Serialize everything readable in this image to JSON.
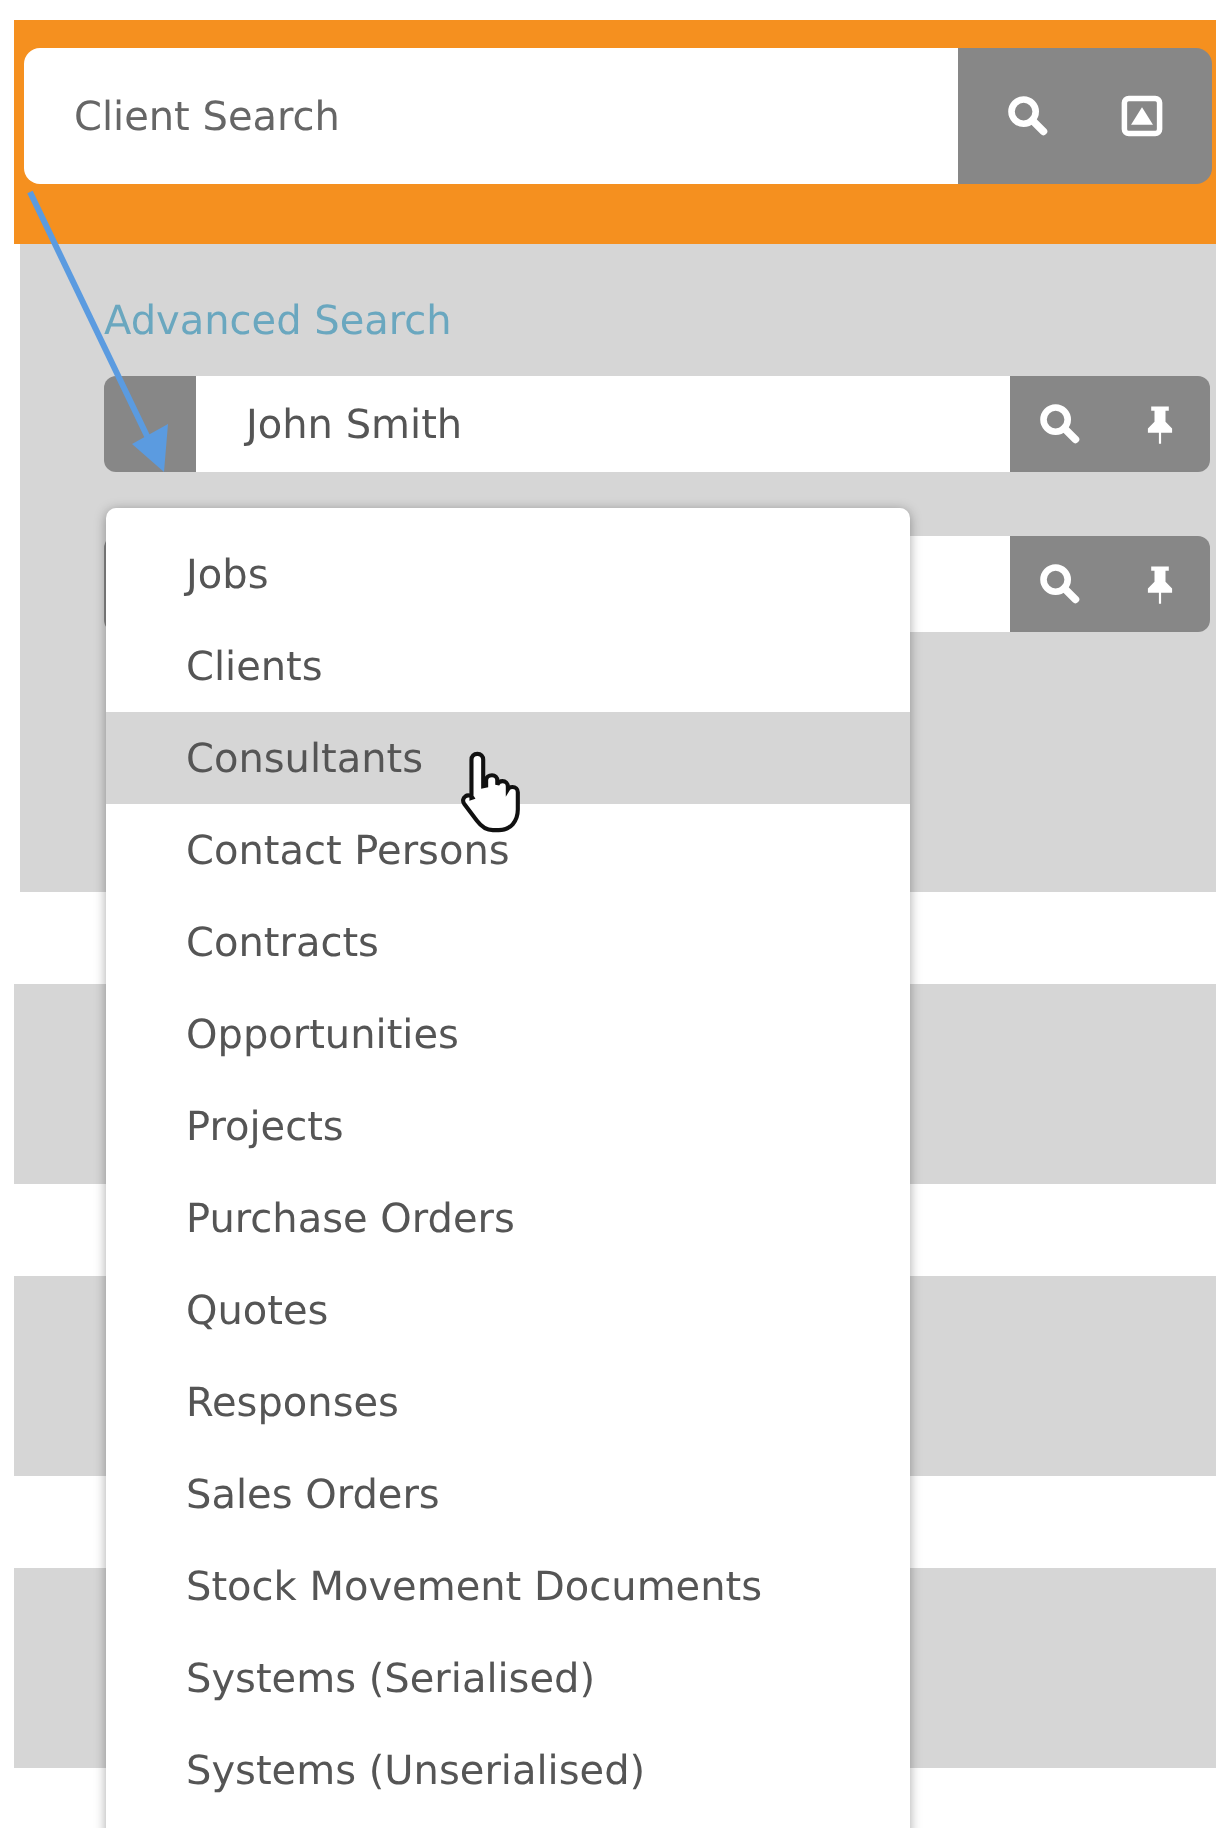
{
  "client_search": {
    "placeholder": "Client Search"
  },
  "advanced_search": {
    "link": "Advanced Search",
    "rows": [
      {
        "value": "John Smith"
      },
      {}
    ]
  },
  "dropdown": {
    "items": [
      {
        "label": "Jobs",
        "selected": false
      },
      {
        "label": "Clients",
        "selected": false
      },
      {
        "label": "Consultants",
        "selected": true
      },
      {
        "label": "Contact Persons",
        "selected": false
      },
      {
        "label": "Contracts",
        "selected": false
      },
      {
        "label": "Opportunities",
        "selected": false
      },
      {
        "label": "Projects",
        "selected": false
      },
      {
        "label": "Purchase Orders",
        "selected": false
      },
      {
        "label": "Quotes",
        "selected": false
      },
      {
        "label": "Responses",
        "selected": false
      },
      {
        "label": "Sales Orders",
        "selected": false
      },
      {
        "label": "Stock Movement Documents",
        "selected": false
      },
      {
        "label": "Systems (Serialised)",
        "selected": false
      },
      {
        "label": "Systems (Unserialised)",
        "selected": false
      }
    ]
  }
}
